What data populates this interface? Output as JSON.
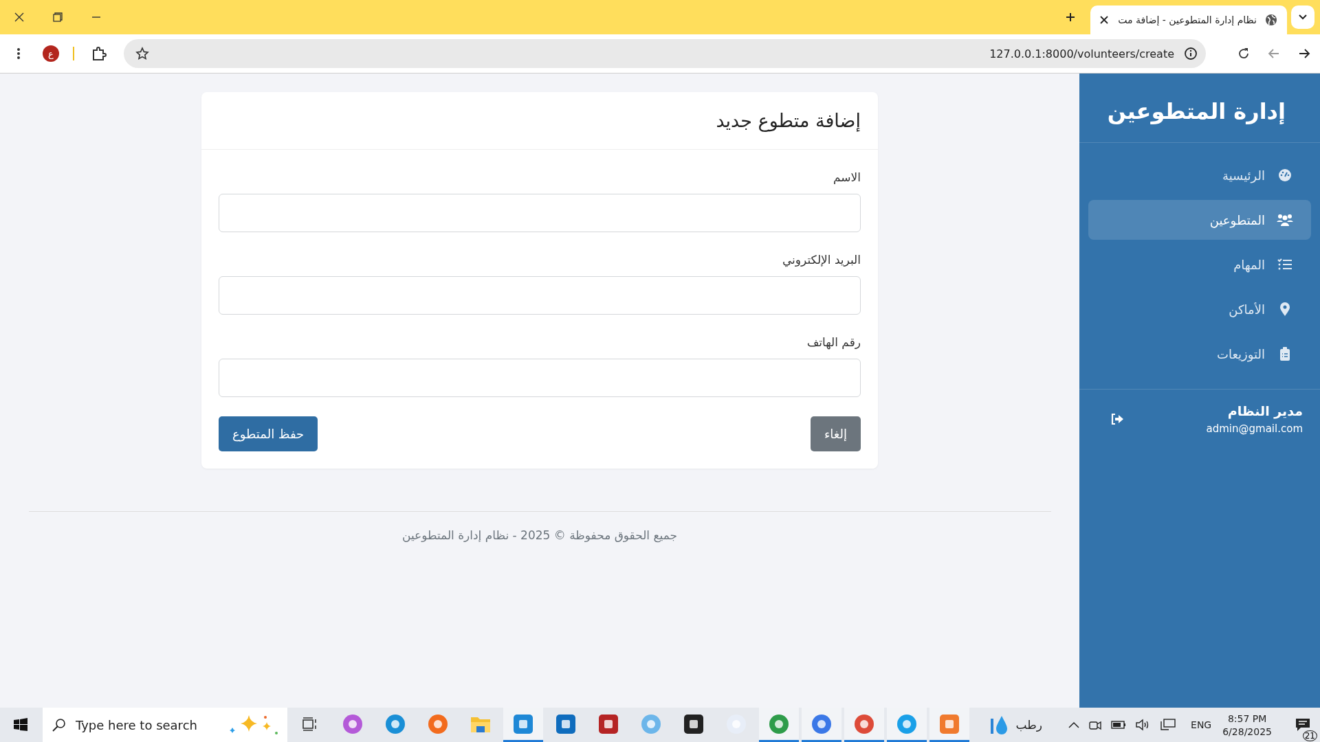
{
  "browser": {
    "tab_title": "نظام إدارة المتطوعين - إضافة مت",
    "profile_initial": "ع",
    "url": "127.0.0.1:8000/volunteers/create"
  },
  "sidebar": {
    "title": "إدارة المتطوعين",
    "items": [
      {
        "label": "الرئيسية",
        "selected": false
      },
      {
        "label": "المتطوعين",
        "selected": true
      },
      {
        "label": "المهام",
        "selected": false
      },
      {
        "label": "الأماكن",
        "selected": false
      },
      {
        "label": "التوزيعات",
        "selected": false
      }
    ],
    "user": {
      "name": "مدير النظام",
      "email": "admin@gmail.com"
    }
  },
  "form": {
    "title": "إضافة متطوع جديد",
    "fields": [
      {
        "label": "الاسم"
      },
      {
        "label": "البريد الإلكتروني"
      },
      {
        "label": "رقم الهاتف"
      }
    ],
    "save_button": "حفظ المتطوع",
    "cancel_button": "إلغاء"
  },
  "footer": "جميع الحقوق محفوظة © 2025 - نظام إدارة المتطوعين",
  "taskbar": {
    "search_placeholder": "Type here to search",
    "apps": [
      {
        "kind": "taskview",
        "open": false
      },
      {
        "kind": "circle",
        "open": false,
        "color": "#b45ad8"
      },
      {
        "kind": "circle",
        "open": false,
        "color": "#1a8fd6"
      },
      {
        "kind": "circle",
        "open": false,
        "color": "#f26b1d"
      },
      {
        "kind": "folder",
        "open": false,
        "color": "#f5c033"
      },
      {
        "kind": "square",
        "open": true,
        "color": "#1e88d6"
      },
      {
        "kind": "square",
        "open": false,
        "color": "#0f6cbd"
      },
      {
        "kind": "square",
        "open": false,
        "color": "#b52424"
      },
      {
        "kind": "circle",
        "open": false,
        "color": "#6cb6ea"
      },
      {
        "kind": "square",
        "open": false,
        "color": "#222222"
      },
      {
        "kind": "circle",
        "open": false,
        "color": "#e8eef8"
      },
      {
        "kind": "circle",
        "open": true,
        "color": "#2e9c4a"
      },
      {
        "kind": "circle",
        "open": true,
        "color": "#3b78e7"
      },
      {
        "kind": "circle",
        "open": true,
        "color": "#dd4b39"
      },
      {
        "kind": "circle",
        "open": true,
        "color": "#1aa0e8"
      },
      {
        "kind": "square",
        "open": true,
        "color": "#f07a2e"
      }
    ],
    "weather": "رطب",
    "language": "ENG",
    "time": "8:57 PM",
    "date": "6/28/2025",
    "notifications": "21"
  }
}
